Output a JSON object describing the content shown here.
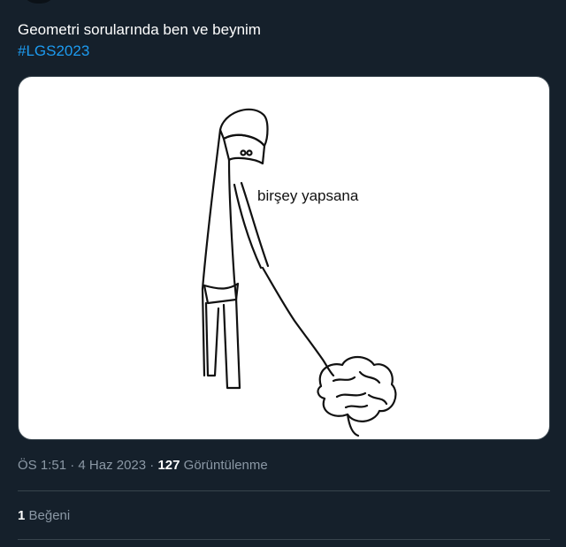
{
  "tweet": {
    "text": "Geometri sorularında ben ve beynim",
    "hashtag": "#LGS2023"
  },
  "media": {
    "caption_text": "birşey yapsana"
  },
  "meta": {
    "time": "ÖS 1:51",
    "separator": "·",
    "date": "4 Haz 2023",
    "views_count": "127",
    "views_label": "Görüntülenme"
  },
  "engagement": {
    "likes_count": "1",
    "likes_label": "Beğeni"
  },
  "colors": {
    "background": "#15202b",
    "link": "#1d9bf0",
    "muted": "#8b98a5",
    "divider": "#38444d"
  }
}
